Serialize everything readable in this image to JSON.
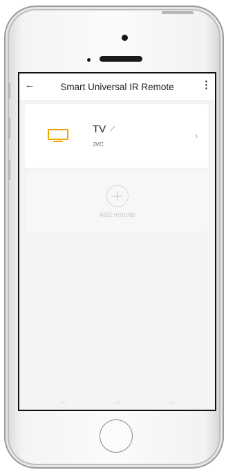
{
  "app": {
    "title": "Smart Universal IR Remote"
  },
  "icons": {
    "back": "arrow-left-icon",
    "menu": "more-vertical-icon",
    "device": "tv-icon",
    "edit": "pencil-icon",
    "open": "chevron-right-icon",
    "add": "plus-circle-icon"
  },
  "devices": [
    {
      "name": "TV",
      "brand": "JVC"
    }
  ],
  "add_remote": {
    "label": "Add remote"
  },
  "colors": {
    "accent": "#f2a300",
    "background": "#f4f4f4"
  }
}
